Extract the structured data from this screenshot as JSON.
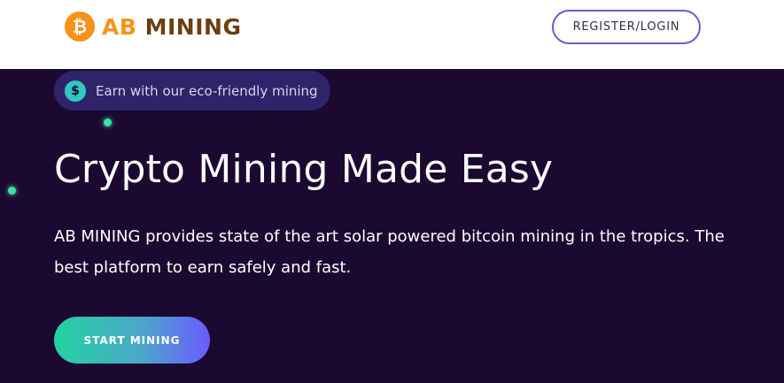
{
  "header": {
    "logo": {
      "icon": "bitcoin-icon",
      "glyph": "₿",
      "brand_prefix": "AB",
      "brand_suffix": "MINING"
    },
    "register_label": "REGISTER/LOGIN"
  },
  "hero": {
    "badge": {
      "icon": "dollar-icon",
      "glyph": "$",
      "text": "Earn with our eco-friendly mining"
    },
    "title": "Crypto Mining Made Easy",
    "description": "AB MINING provides state of the art solar powered bitcoin mining in the tropics. The best platform to earn safely and fast.",
    "cta_label": "START MINING"
  },
  "colors": {
    "brand_orange": "#f7931a",
    "brand_brown": "#6b3f0f",
    "hero_bg": "#1b0931",
    "accent_purple": "#7357c9",
    "gradient_start": "#22d39d",
    "gradient_end": "#6b5bff"
  }
}
